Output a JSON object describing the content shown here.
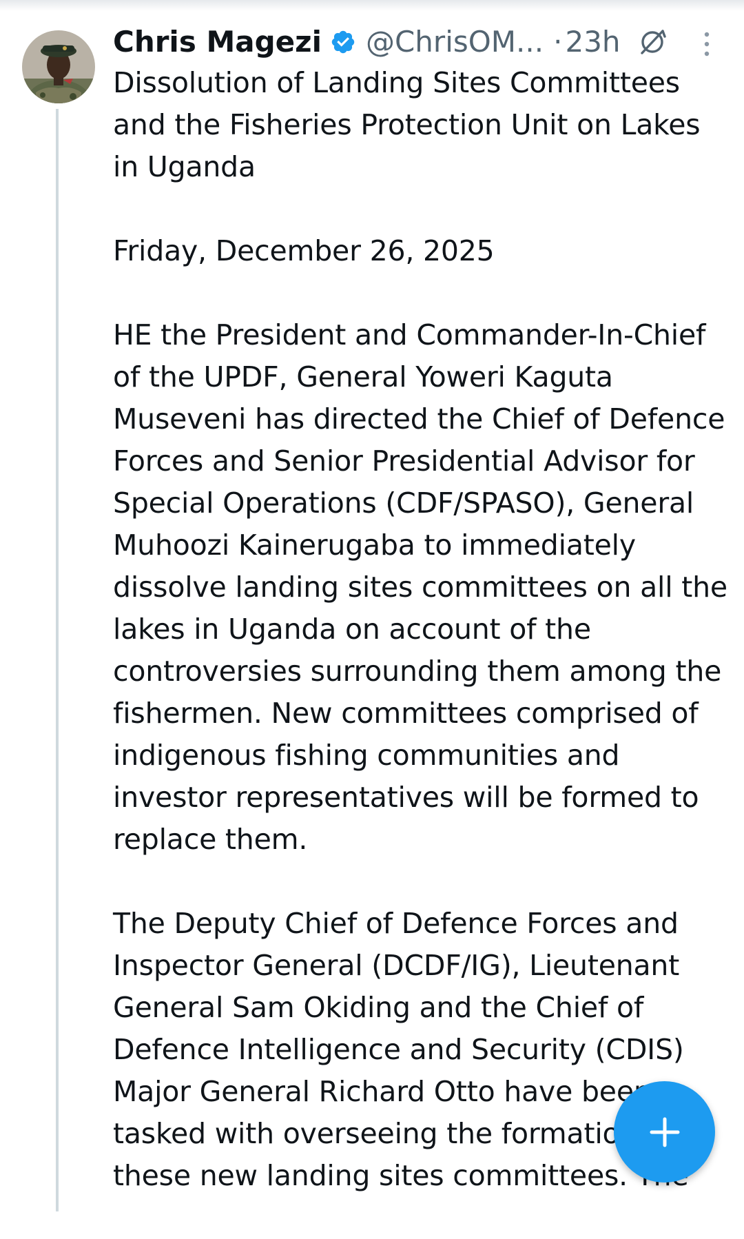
{
  "tweet": {
    "author": {
      "display_name": "Chris Magezi",
      "handle": "@ChrisOM...",
      "verified": true,
      "avatar_icon": "avatar-photo"
    },
    "time_sep": "·",
    "time": "23h",
    "paragraphs": [
      "Dissolution of Landing Sites Committees and the Fisheries Protection Unit on Lakes in Uganda",
      "Friday, December 26, 2025",
      "HE the President and Commander-In-Chief of the UPDF, General Yoweri Kaguta Museveni has directed the Chief of Defence Forces and Senior Presidential Advisor for Special Operations (CDF/SPASO), General Muhoozi Kainerugaba to immediately dissolve landing sites committees on all the lakes in Uganda on account of the controversies surrounding them among the fishermen. New committees comprised of indigenous fishing communities and investor representatives will be formed to replace them.",
      "The Deputy Chief of Defence Forces and Inspector General (DCDF/IG), Lieutenant General Sam Okiding and the Chief of Defence Intelligence and Security (CDIS) Major General Richard Otto have been tasked with overseeing the formation of these new landing sites committees. The"
    ]
  },
  "icons": {
    "verified": "verified-badge-icon",
    "grok": "grok-icon",
    "more": "more-vertical-icon",
    "compose": "plus-icon"
  },
  "colors": {
    "accent": "#1d9bf0",
    "text": "#0f1419",
    "muted": "#536471",
    "thread_line": "#cfd9de"
  }
}
